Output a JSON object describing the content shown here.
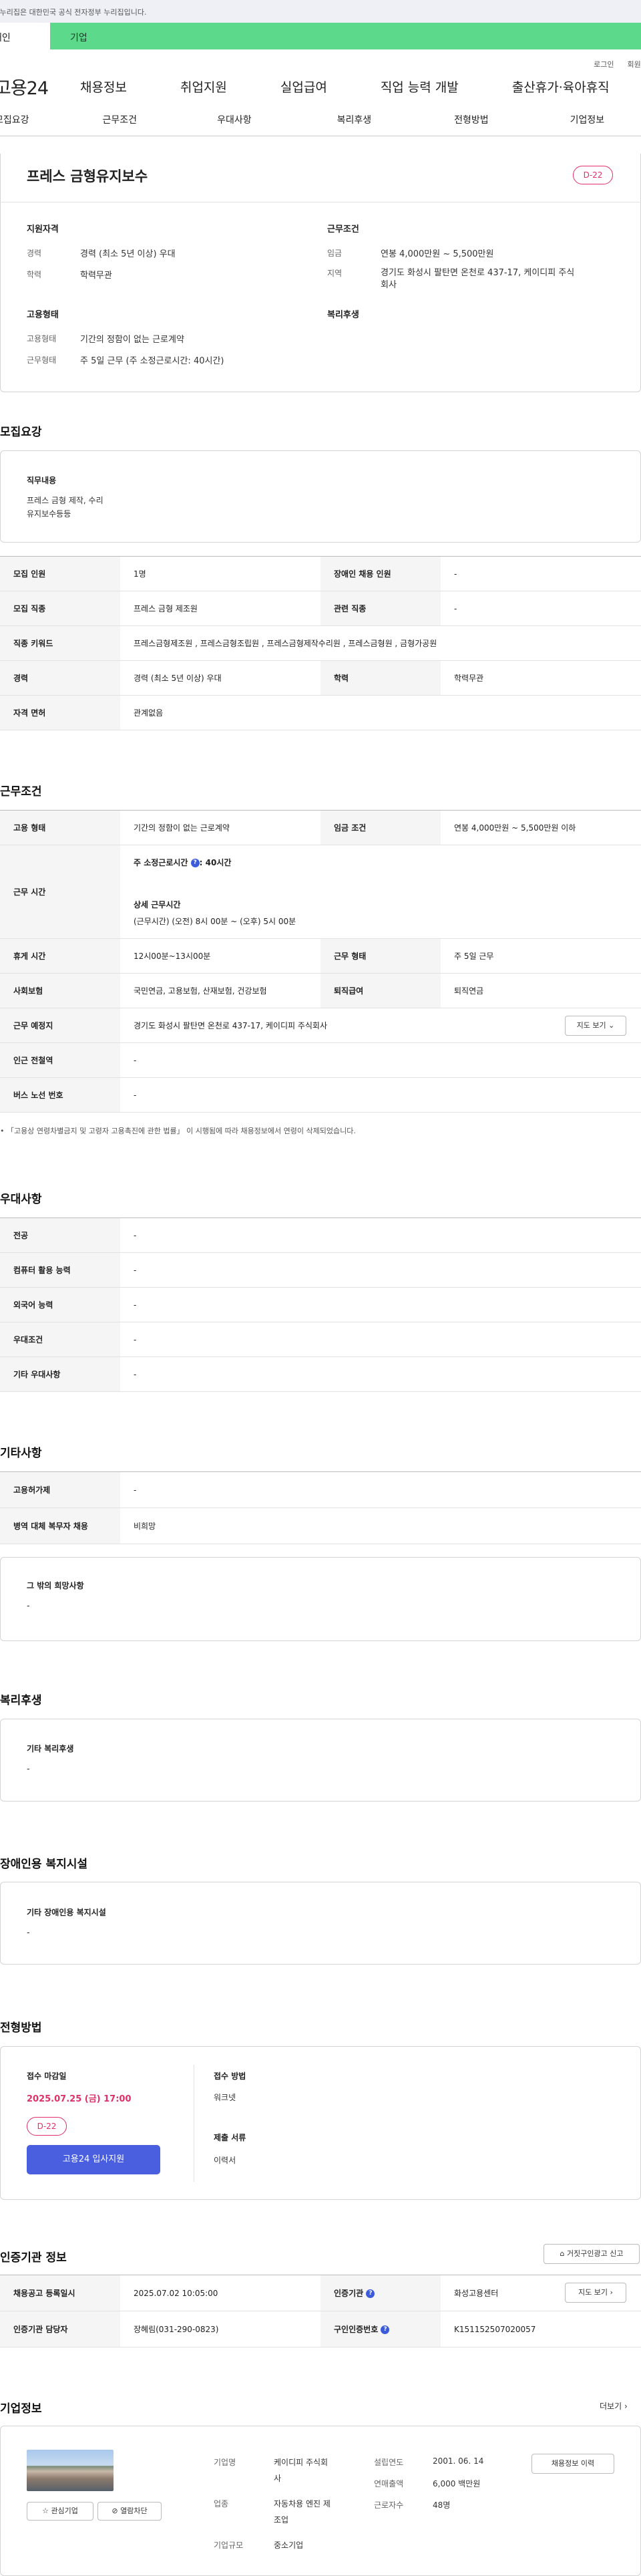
{
  "top": {
    "gov_notice": "이 누리집은 대한민국 공식 전자정부 누리집입니다.",
    "tab_person": "개인",
    "tab_company": "기업",
    "login": "로그인",
    "join": "회원가입"
  },
  "gnb": {
    "logo": "고용24",
    "items": [
      "채용정보",
      "취업지원",
      "실업급여",
      "직업 능력 개발",
      "출산휴가·육아휴직"
    ]
  },
  "snb": {
    "items": [
      "모집요강",
      "근무조건",
      "우대사항",
      "복리후생",
      "전형방법",
      "기업정보"
    ]
  },
  "summary": {
    "title": "프레스 금형유지보수",
    "dday": "D-22",
    "qual_title": "지원자격",
    "career_label": "경력",
    "career_value": "경력 (최소 5년 이상) 우대",
    "edu_label": "학력",
    "edu_value": "학력무관",
    "emp_title": "고용형태",
    "emptype_label": "고용형태",
    "emptype_value": "기간의 정함이 없는 근로계약",
    "work_label": "근무형태",
    "work_value": "주 5일 근무 (주 소정근로시간: 40시간)",
    "cond_title": "근무조건",
    "wage_label": "임금",
    "wage_value": "연봉 4,000만원 ~ 5,500만원",
    "area_label": "지역",
    "area_value1": "경기도 화성시 팔탄면 온천로 437-17, 케이디피 주식",
    "area_value2": "회사",
    "welfare_title": "복리후생"
  },
  "recruit": {
    "title": "모집요강",
    "duty_title": "직무내용",
    "duty_line1": "프레스 금형 제작, 수리",
    "duty_line2": "유지보수등등",
    "rows": [
      [
        "모집 인원",
        "1명",
        "장애인 채용 인원",
        "-"
      ],
      [
        "모집 직종",
        "프레스 금형 제조원",
        "관련 직종",
        "-"
      ],
      [
        "직종 키워드",
        "프레스금형제조원 , 프레스금형조립원 , 프레스금형제작수리원 , 프레스금형원 , 금형가공원",
        "",
        ""
      ],
      [
        "경력",
        "경력 (최소 5년 이상) 우대",
        "학력",
        "학력무관"
      ],
      [
        "자격 면허",
        "관계없음",
        "",
        ""
      ]
    ]
  },
  "condition": {
    "title": "근무조건",
    "emp_label": "고용 형태",
    "emp_value": "기간의 정함이 없는 근로계약",
    "wage_label": "임금 조건",
    "wage_value": "연봉 4,000만원 ~ 5,500만원 이하",
    "time_label": "근무 시간",
    "time_main": "주 소정근로시간",
    "time_hours": "40시간",
    "time_detail_title": "상세 근무시간",
    "time_detail": "(근무시간) (오전) 8시 00분 ~ (오후) 5시 00분",
    "rest_label": "휴게 시간",
    "rest_value": "12시00분~13시00분",
    "form_label": "근무 형태",
    "form_value": "주 5일 근무",
    "ins_label": "사회보험",
    "ins_value": "국민연금, 고용보험, 산재보험, 건강보험",
    "ret_label": "퇴직급여",
    "ret_value": "퇴직연금",
    "place_label": "근무 예정지",
    "place_value": "경기도 화성시 팔탄면 온천로 437-17, 케이디피 주식회사",
    "map_btn": "지도 보기",
    "sub_label": "인근 전철역",
    "sub_value": "-",
    "bus_label": "버스 노선 번호",
    "bus_value": "-",
    "note": "「고용상 연령차별금지 및 고령자 고용촉진에 관한 법률」 이 시행됨에 따라 채용정보에서 연령이 삭제되었습니다."
  },
  "pref": {
    "title": "우대사항",
    "rows": [
      [
        "전공",
        "-"
      ],
      [
        "컴퓨터 활용 능력",
        "-"
      ],
      [
        "외국어 능력",
        "-"
      ],
      [
        "우대조건",
        "-"
      ],
      [
        "기타 우대사항",
        "-"
      ]
    ]
  },
  "etc": {
    "title": "기타사항",
    "rows": [
      [
        "고용허가제",
        "-"
      ],
      [
        "병역 대체 복무자 채용",
        "비희망"
      ]
    ],
    "hope_title": "그 밖의 희망사항",
    "hope_value": "-"
  },
  "welfare": {
    "title": "복리후생",
    "sub": "기타 복리후생",
    "value": "-"
  },
  "disabled": {
    "title": "장애인용 복지시설",
    "sub": "기타 장애인용 복지시설",
    "value": "-"
  },
  "selection": {
    "title": "전형방법",
    "deadline_label": "접수 마감일",
    "deadline": "2025.07.25 (금) 17:00",
    "dday": "D-22",
    "apply_btn": "고용24 입사지원",
    "method_label": "접수 방법",
    "method_value": "워크넷",
    "docs_label": "제출 서류",
    "docs_value": "이력서"
  },
  "agency": {
    "title": "인증기관 정보",
    "report_btn": "거짓구인광고 신고",
    "reg_label": "채용공고 등록일시",
    "reg_value": "2025.07.02 10:05:00",
    "org_label": "인증기관",
    "org_value": "화성고용센터",
    "map_btn": "지도 보기",
    "mgr_label": "인증기관 담당자",
    "mgr_value": "장혜림(031-290-0823)",
    "num_label": "구인인증번호",
    "num_value": "K151152507020057"
  },
  "company": {
    "title": "기업정보",
    "more": "더보기",
    "fav_btn": "관심기업",
    "block_btn": "열람차단",
    "name_label": "기업명",
    "name_value1": "케이디피 주식회",
    "name_value2": "사",
    "ind_label": "업종",
    "ind_value1": "자동차용 엔진 제",
    "ind_value2": "조업",
    "size_label": "기업규모",
    "size_value": "중소기업",
    "est_label": "설립연도",
    "est_value": "2001. 06. 14",
    "sales_label": "연매출액",
    "sales_value": "6,000 백만원",
    "staff_label": "근로자수",
    "staff_value": "48명",
    "history_btn": "채용정보 이력"
  }
}
